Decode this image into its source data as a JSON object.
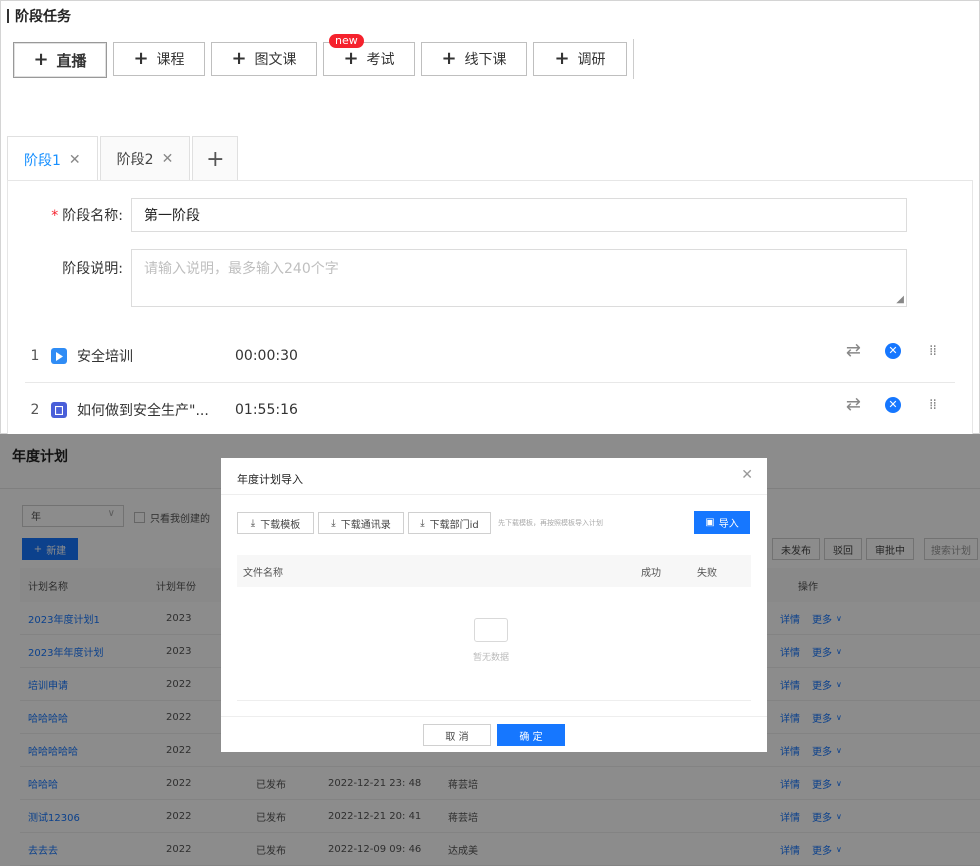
{
  "stage_editor": {
    "section_title": "阶段任务",
    "toolbar": [
      {
        "label": "直播"
      },
      {
        "label": "课程"
      },
      {
        "label": "图文课"
      },
      {
        "label": "考试",
        "badge": "new"
      },
      {
        "label": "线下课"
      },
      {
        "label": "调研"
      }
    ],
    "tabs": [
      {
        "label": "阶段1",
        "active": true
      },
      {
        "label": "阶段2",
        "active": false
      }
    ],
    "form": {
      "name_label": "阶段名称:",
      "name_value": "第一阶段",
      "desc_label": "阶段说明:",
      "desc_placeholder": "请输入说明，最多输入240个字"
    },
    "items": [
      {
        "index": "1",
        "icon": "play-icon",
        "name": "安全培训",
        "duration": "00:00:30"
      },
      {
        "index": "2",
        "icon": "doc-icon",
        "name": "如何做到安全生产\"...",
        "duration": "01:55:16"
      }
    ]
  },
  "annual_plan": {
    "page_title": "年度计划",
    "filter": {
      "year_select": "年",
      "only_mine_label": "只看我创建的"
    },
    "new_button": "新建",
    "status_buttons": [
      "未发布",
      "驳回",
      "审批中"
    ],
    "search_button": "搜索计划",
    "columns": {
      "name": "计划名称",
      "year": "计划年份",
      "action": "操作"
    },
    "rows": [
      {
        "name": "2023年度计划1",
        "year": "2023",
        "status": "",
        "time": "",
        "creator": "",
        "detail": "详情",
        "more": "更多"
      },
      {
        "name": "2023年年度计划",
        "year": "2023",
        "status": "",
        "time": "",
        "creator": "",
        "detail": "详情",
        "more": "更多"
      },
      {
        "name": "培训申请",
        "year": "2022",
        "status": "",
        "time": "",
        "creator": "",
        "detail": "详情",
        "more": "更多"
      },
      {
        "name": "哈哈哈哈",
        "year": "2022",
        "status": "",
        "time": "",
        "creator": "",
        "detail": "详情",
        "more": "更多"
      },
      {
        "name": "哈哈哈哈哈",
        "year": "2022",
        "status": "",
        "time": "",
        "creator": "",
        "detail": "详情",
        "more": "更多"
      },
      {
        "name": "哈哈哈",
        "year": "2022",
        "status": "已发布",
        "time": "2022-12-21 23: 48",
        "creator": "蒋芸培",
        "detail": "详情",
        "more": "更多"
      },
      {
        "name": "测试12306",
        "year": "2022",
        "status": "已发布",
        "time": "2022-12-21 20: 41",
        "creator": "蒋芸培",
        "detail": "详情",
        "more": "更多"
      },
      {
        "name": "去去去",
        "year": "2022",
        "status": "已发布",
        "time": "2022-12-09 09: 46",
        "creator": "达成美",
        "detail": "详情",
        "more": "更多"
      }
    ]
  },
  "import_modal": {
    "title": "年度计划导入",
    "buttons": [
      "下载模板",
      "下载通讯录",
      "下载部门id"
    ],
    "hint": "先下载模板，再按照模板导入计划",
    "import_label": "导入",
    "columns": {
      "file_name": "文件名称",
      "success": "成功",
      "fail": "失败"
    },
    "empty_text": "暂无数据",
    "cancel": "取 消",
    "ok": "确 定"
  },
  "colors": {
    "primary": "#1677ff",
    "tab_active": "#1890ff",
    "badge": "#f5222d"
  }
}
